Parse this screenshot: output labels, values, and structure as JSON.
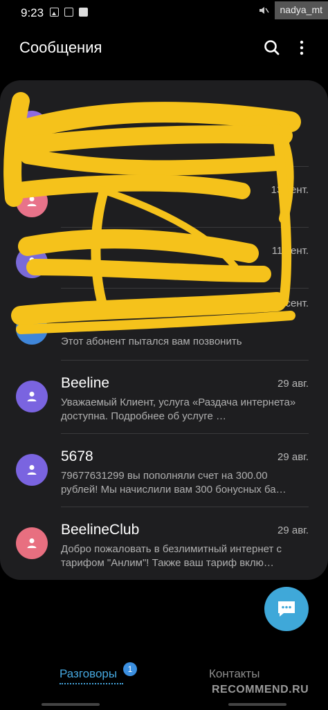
{
  "status_bar": {
    "time": "9:23",
    "icons": [
      "image-icon",
      "notification-icon",
      "check-icon",
      "mute-icon"
    ]
  },
  "watermark": {
    "user": "nadya_mt",
    "site": "RECOMMEND.RU"
  },
  "header": {
    "title": "Сообщения",
    "icons": [
      "search-icon",
      "more-icon"
    ]
  },
  "conversations": [
    {
      "name": "",
      "date": "",
      "preview": "",
      "avatar_color": "#8e6be0"
    },
    {
      "name": "",
      "date": "13 сент.",
      "preview": "",
      "avatar_color": "#e8738a"
    },
    {
      "name": "",
      "date": "11 сент.",
      "preview": "",
      "avatar_color": "#7a6ad8"
    },
    {
      "name": "",
      "date": "7 сент.",
      "preview": "Этот абонент пытался вам позвонить",
      "avatar_color": "#3f86d9"
    },
    {
      "name": "Beeline",
      "date": "29 авг.",
      "preview": "Уважаемый Клиент, услуга «Раздача интернета» доступна. Подробнее об услуге …",
      "avatar_color": "#7a64e0"
    },
    {
      "name": "5678",
      "date": "29 авг.",
      "preview": "79677631299 вы пополняли счет на 300.00 рублей! Мы начислили вам 300 бонусных ба…",
      "avatar_color": "#7a64e0"
    },
    {
      "name": "BeelineClub",
      "date": "29 авг.",
      "preview": "Добро пожаловать в безлимитный интернет с тарифом \"Анлим\"! Также ваш тариф вклю…",
      "avatar_color": "#e86f80"
    }
  ],
  "fab": {
    "icon": "chat-icon"
  },
  "tabs": [
    {
      "label": "Разговоры",
      "badge": "1",
      "active": true
    },
    {
      "label": "Контакты",
      "active": false
    }
  ],
  "colors": {
    "accent": "#46a8e0",
    "fab": "#3fa8d9",
    "scribble": "#f5c21b",
    "card": "#1e1e20"
  }
}
